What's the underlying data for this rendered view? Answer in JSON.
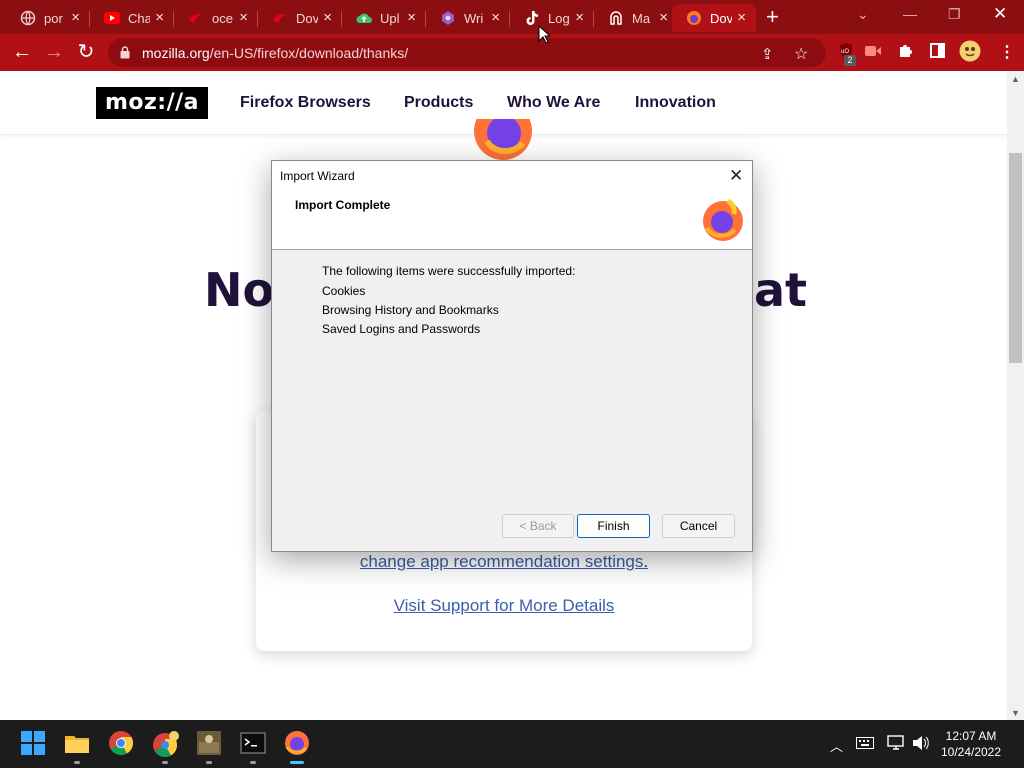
{
  "browser": {
    "tabs": [
      {
        "title": "por",
        "icon": "globe-icon"
      },
      {
        "title": "Cha",
        "icon": "youtube-icon"
      },
      {
        "title": "oce",
        "icon": "red-logo-icon"
      },
      {
        "title": "Dov",
        "icon": "red-logo-icon"
      },
      {
        "title": "Upl",
        "icon": "upload-cloud-icon"
      },
      {
        "title": "Wri",
        "icon": "purple-app-icon"
      },
      {
        "title": "Log",
        "icon": "tiktok-icon"
      },
      {
        "title": "Ma",
        "icon": "arch-icon"
      },
      {
        "title": "Dov",
        "icon": "firefox-icon",
        "active": true
      }
    ],
    "new_tab": "+",
    "url_domain": "mozilla.org",
    "url_path": "/en-US/firefox/download/thanks/",
    "extension_badge": "2",
    "accent_color": "#b11116"
  },
  "site": {
    "logo": "moz://a",
    "nav": [
      "Firefox Browsers",
      "Products",
      "Who We Are",
      "Innovation"
    ],
    "heading_left": "No",
    "heading_right": "at",
    "link_settings": "change app recommendation settings",
    "link_settings_suffix": ".",
    "link_support": "Visit Support for More Details"
  },
  "dialog": {
    "title": "Import Wizard",
    "heading": "Import Complete",
    "message": "The following items were successfully imported:",
    "items": [
      "Cookies",
      "Browsing History and Bookmarks",
      "Saved Logins and Passwords"
    ],
    "buttons": {
      "back": "< Back",
      "finish": "Finish",
      "cancel": "Cancel"
    }
  },
  "taskbar": {
    "apps": [
      "start-icon",
      "file-explorer-icon",
      "chrome-icon",
      "chrome-profile-icon",
      "game-icon",
      "terminal-icon",
      "firefox-icon"
    ],
    "time": "12:07 AM",
    "date": "10/24/2022"
  }
}
